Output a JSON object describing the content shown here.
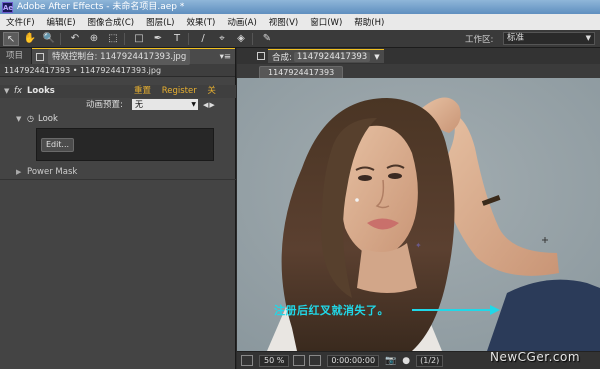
{
  "window": {
    "title": "Adobe After Effects - 未命名项目.aep *",
    "logo_text": "Ae"
  },
  "menu": [
    "文件(F)",
    "编辑(E)",
    "图像合成(C)",
    "图层(L)",
    "效果(T)",
    "动画(A)",
    "视图(V)",
    "窗口(W)",
    "帮助(H)"
  ],
  "toolbar": {
    "tools": [
      "↖",
      "✋",
      "🔍",
      "↶",
      "⊕",
      "⬚",
      "□",
      "✒",
      "T",
      "/",
      "⌖",
      "◈",
      "✎"
    ],
    "workspace_label": "工作区:",
    "workspace_value": "标准"
  },
  "left_panel": {
    "tab_project": "项目",
    "tab_effects": "特效控制台: 1147924417393.jpg",
    "header": "1147924417393 • 1147924417393.jpg",
    "effect": {
      "fx_label": "fx",
      "name": "Looks",
      "links": [
        "重置",
        "Register",
        "关于..."
      ],
      "preset_label": "动画预置:",
      "preset_value": "无",
      "look_label": "Look",
      "edit_button": "Edit...",
      "power_mask": "Power Mask"
    }
  },
  "right_panel": {
    "comp_tab_prefix": "合成:",
    "comp_tab_name": "1147924417393",
    "subtab": "1147924417393",
    "annotation": "注册后红叉就消失了。",
    "viewer_bar": {
      "zoom": "50 %",
      "timecode": "0:00:00:00",
      "resolution": "(1/2)"
    }
  },
  "watermark": "NewCGer.com",
  "colors": {
    "annotation": "#20d8e8",
    "link": "#e8b030",
    "tab_highlight": "#f0c020"
  }
}
